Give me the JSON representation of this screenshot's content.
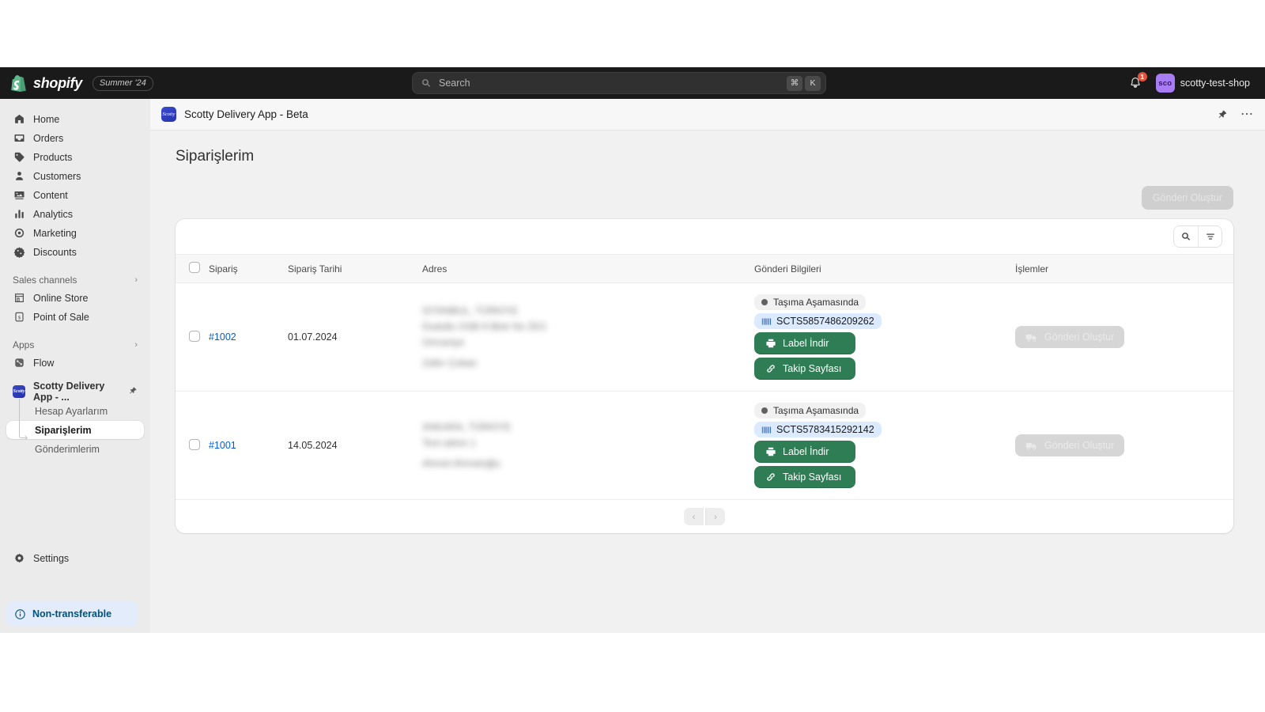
{
  "topbar": {
    "brand_name": "shopify",
    "season_badge": "Summer '24",
    "search_placeholder": "Search",
    "kbd_cmd": "⌘",
    "kbd_key": "K",
    "notification_count": "1",
    "avatar_initials": "sco",
    "shop_name": "scotty-test-shop"
  },
  "sidebar": {
    "primary": [
      {
        "label": "Home",
        "icon": "home-icon"
      },
      {
        "label": "Orders",
        "icon": "orders-icon"
      },
      {
        "label": "Products",
        "icon": "products-icon"
      },
      {
        "label": "Customers",
        "icon": "customers-icon"
      },
      {
        "label": "Content",
        "icon": "content-icon"
      },
      {
        "label": "Analytics",
        "icon": "analytics-icon"
      },
      {
        "label": "Marketing",
        "icon": "marketing-icon"
      },
      {
        "label": "Discounts",
        "icon": "discounts-icon"
      }
    ],
    "sales_channels": {
      "title": "Sales channels",
      "items": [
        {
          "label": "Online Store",
          "icon": "store-icon"
        },
        {
          "label": "Point of Sale",
          "icon": "pos-icon"
        }
      ]
    },
    "apps": {
      "title": "Apps",
      "items": [
        {
          "label": "Flow",
          "icon": "flow-icon"
        }
      ]
    },
    "app_nav": {
      "app_label": "Scotty Delivery App - ...",
      "app_icon_text": "Scotty",
      "sub_items": [
        {
          "label": "Hesap Ayarlarım",
          "active": false
        },
        {
          "label": "Siparişlerim",
          "active": true
        },
        {
          "label": "Gönderimlerim",
          "active": false
        }
      ]
    },
    "settings_label": "Settings",
    "banner_label": "Non-transferable"
  },
  "appbar": {
    "title": "Scotty Delivery App - Beta",
    "icon_text": "Scotty"
  },
  "page": {
    "title": "Siparişlerim",
    "primary_action": "Gönderi Oluştur"
  },
  "table": {
    "headers": {
      "order": "Sipariş",
      "date": "Sipariş Tarihi",
      "address": "Adres",
      "shipment": "Gönderi Bilgileri",
      "actions": "İşlemler"
    },
    "rows": [
      {
        "order": "#1002",
        "date": "01.07.2024",
        "address_lines": [
          "ISTANBUL, TÜRKİYE",
          "Dudullu OSB 8 Blok No 35/1",
          "Ümraniye",
          "Zafer Çoban"
        ],
        "status": "Taşıma Aşamasında",
        "tracking_number": "SCTS5857486209262",
        "label_button": "Label İndir",
        "tracking_button": "Takip Sayfası",
        "action_button": "Gönderi Oluştur"
      },
      {
        "order": "#1001",
        "date": "14.05.2024",
        "address_lines": [
          "ANKARA, TÜRKİYE",
          "Test adres 1",
          "Ahmet Ahmetoğlu"
        ],
        "status": "Taşıma Aşamasında",
        "tracking_number": "SCTS5783415292142",
        "label_button": "Label İndir",
        "tracking_button": "Takip Sayfası",
        "action_button": "Gönderi Oluştur"
      }
    ],
    "pagination": {
      "prev": "‹",
      "next": "›"
    }
  },
  "colors": {
    "topbar_bg": "#1a1a1a",
    "sidebar_bg": "#ebebeb",
    "accent_link": "#005bd3",
    "green_button": "#2f7d55",
    "track_badge_bg": "#dbeaff",
    "banner_bg": "#e3ecfb",
    "avatar_bg": "#a87cf5",
    "notification_badge": "#e0533d"
  }
}
